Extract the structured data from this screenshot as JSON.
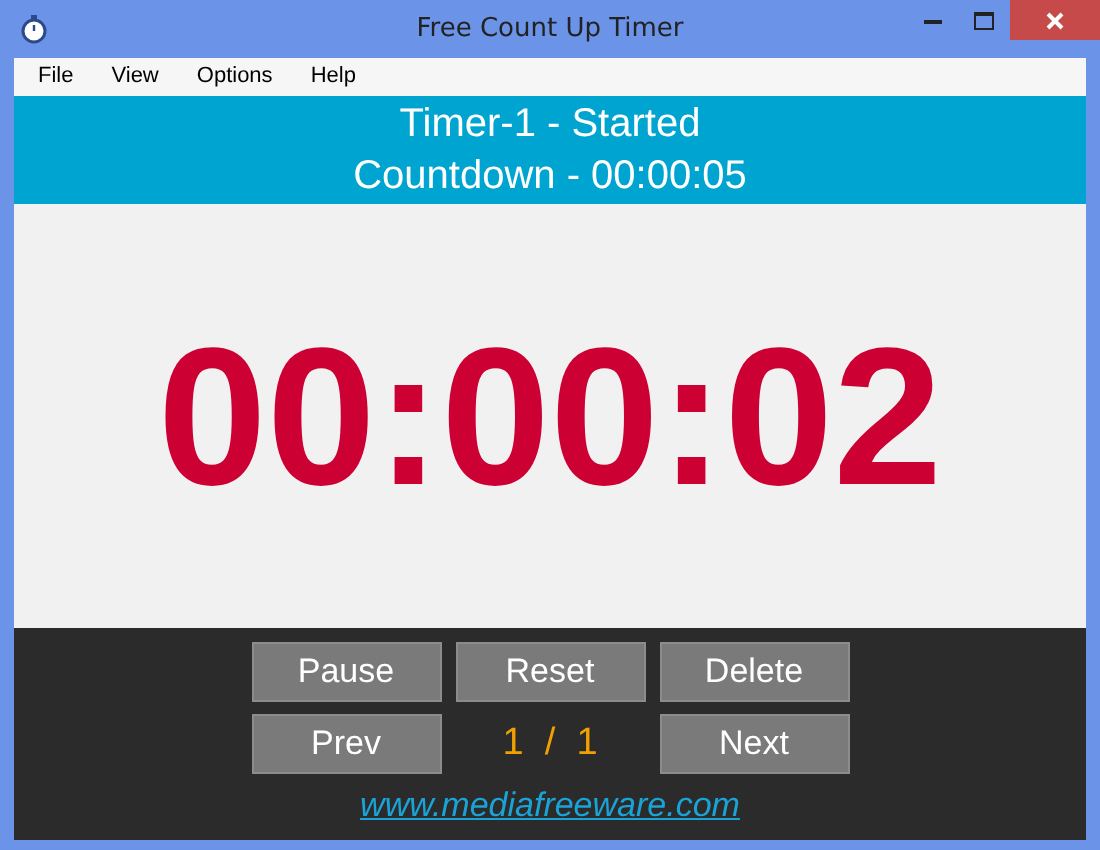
{
  "window": {
    "title": "Free Count Up Timer"
  },
  "menu": [
    {
      "label": "File"
    },
    {
      "label": "View"
    },
    {
      "label": "Options"
    },
    {
      "label": "Help"
    }
  ],
  "header": {
    "timer_status": "Timer-1 - Started",
    "countdown": "Countdown - 00:00:05"
  },
  "time_display": "00:00:02",
  "buttons_row_1": [
    "Pause",
    "Reset",
    "Delete"
  ],
  "prev_button": "Prev",
  "page_counter": "1  /  1",
  "next_button": "Next",
  "link": "www.mediafreeware.com"
}
